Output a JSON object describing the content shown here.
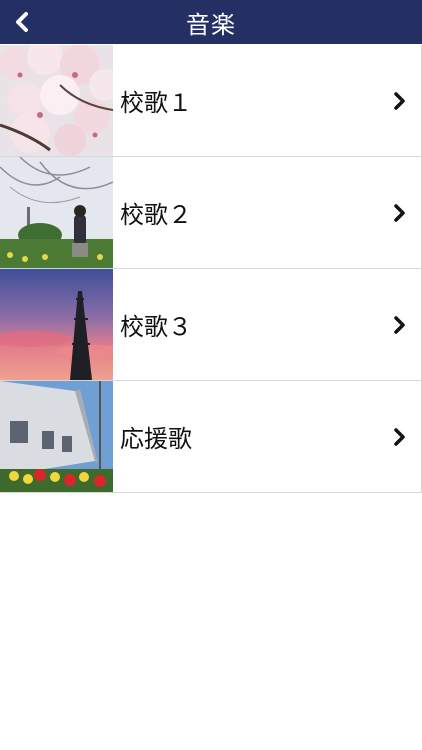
{
  "header": {
    "title": "音楽",
    "back_icon": "chevron-left-icon",
    "background": "#243064"
  },
  "list": {
    "items": [
      {
        "label": "校歌１",
        "thumbnail": "cherry-blossom-photo"
      },
      {
        "label": "校歌２",
        "thumbnail": "student-under-tree-photo"
      },
      {
        "label": "校歌３",
        "thumbnail": "sunset-tower-photo"
      },
      {
        "label": "応援歌",
        "thumbnail": "building-tulips-photo"
      }
    ],
    "chevron_icon": "chevron-right-icon"
  }
}
